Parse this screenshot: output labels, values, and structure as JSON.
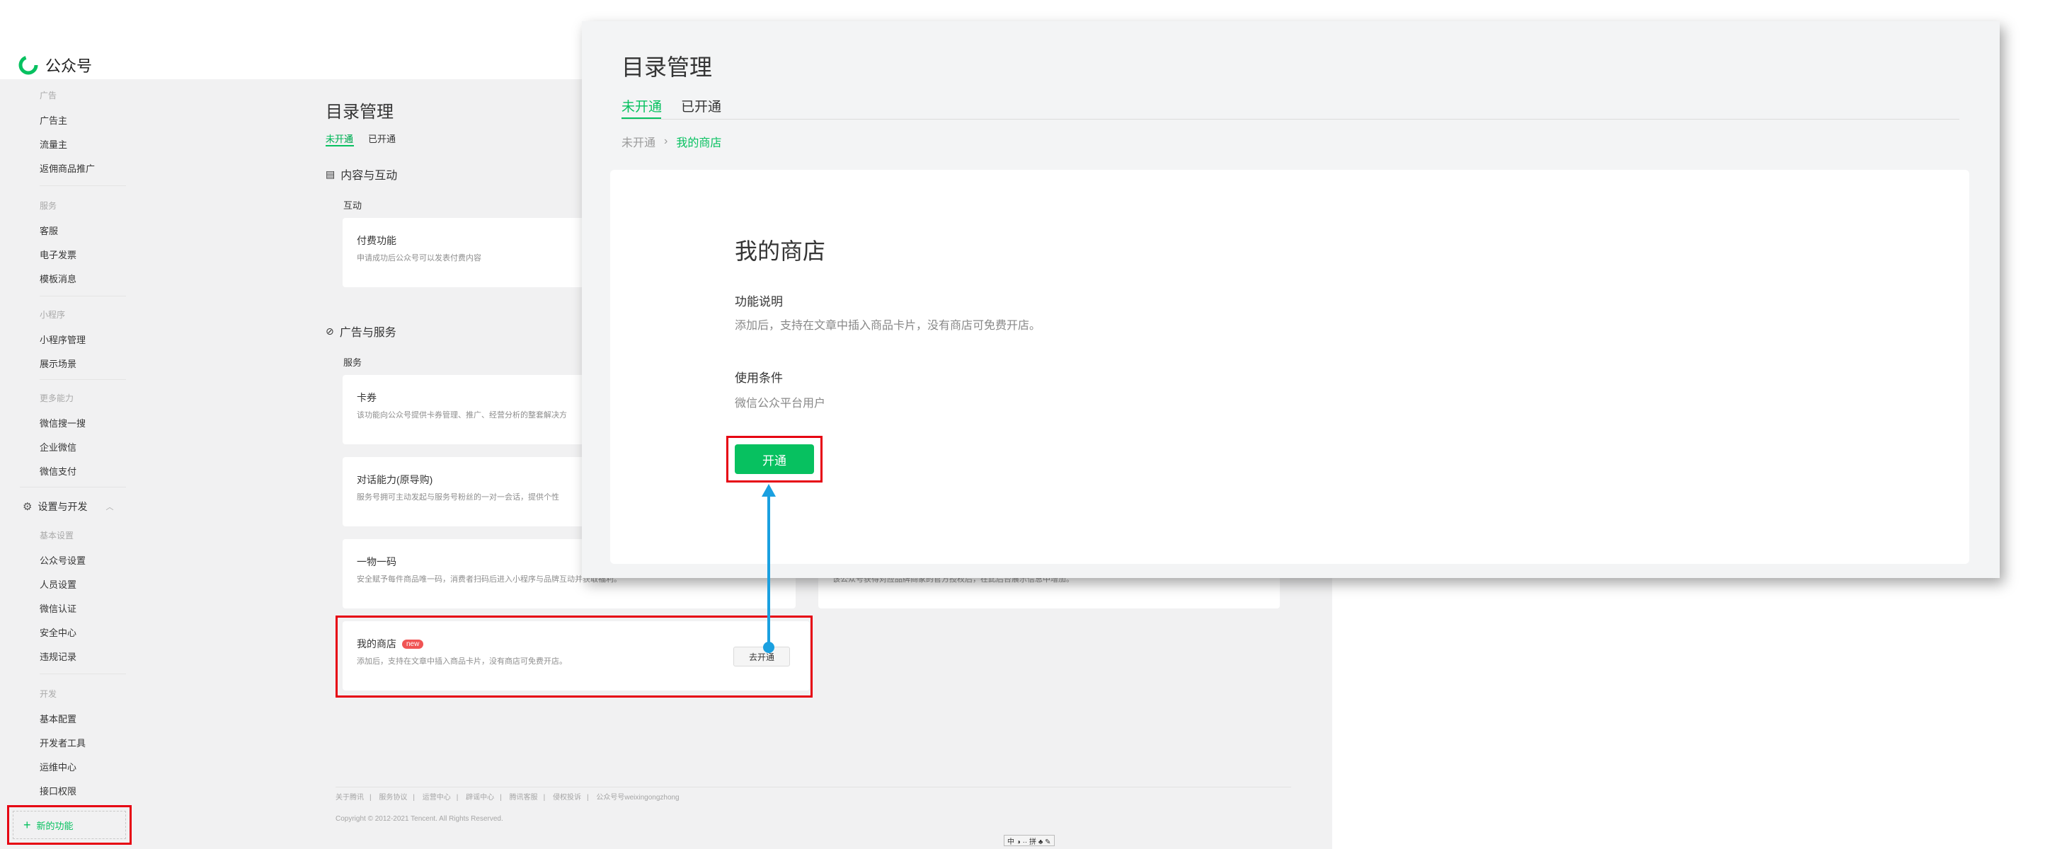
{
  "app": {
    "title": "公众号"
  },
  "sidebar": {
    "groups": [
      {
        "head": "广告",
        "items": [
          "广告主",
          "流量主",
          "返佣商品推广"
        ]
      },
      {
        "head": "服务",
        "items": [
          "客服",
          "电子发票",
          "模板消息"
        ]
      },
      {
        "head": "小程序",
        "items": [
          "小程序管理",
          "展示场景"
        ]
      },
      {
        "head": "更多能力",
        "items": [
          "微信搜一搜",
          "企业微信",
          "微信支付"
        ]
      }
    ],
    "section2": {
      "title": "设置与开发",
      "icon": "gear-icon"
    },
    "groups2": [
      {
        "head": "基本设置",
        "items": [
          "公众号设置",
          "人员设置",
          "微信认证",
          "安全中心",
          "违规记录"
        ]
      },
      {
        "head": "开发",
        "items": [
          "基本配置",
          "开发者工具",
          "运维中心",
          "接口权限"
        ]
      }
    ],
    "new_feature": "新的功能"
  },
  "page": {
    "title": "目录管理",
    "tabs": [
      "未开通",
      "已开通"
    ],
    "section1": {
      "title": "内容与互动",
      "sub": "互动"
    },
    "card_paid": {
      "title": "付费功能",
      "desc": "申请成功后公众号可以发表付费内容"
    },
    "section2": {
      "title": "广告与服务",
      "sub": "服务"
    },
    "card_coupon": {
      "title": "卡券",
      "desc": "该功能向公众号提供卡券管理、推广、经营分析的整套解决方"
    },
    "card_dialog": {
      "title": "对话能力(原导购)",
      "desc": "服务号拥可主动发起与服务号粉丝的一对一会话，提供个性"
    },
    "card_code": {
      "title": "一物一码",
      "desc": "安全赋予每件商品唯一码，消费者扫码后进入小程序与品牌互动并获取福利。"
    },
    "card_right_desc": "该公众号获得对应品牌商家的官方授权后，在此后台展示信息中增加。",
    "card_shop": {
      "title": "我的商店",
      "badge": "new",
      "desc": "添加后，支持在文章中插入商品卡片，没有商店可免费开店。",
      "button": "去开通"
    },
    "footer_links": [
      "关于腾讯",
      "服务协议",
      "运营中心",
      "辟谣中心",
      "腾讯客服",
      "侵权投诉",
      "公众号号weixingongzhong"
    ],
    "copyright": "Copyright © 2012-2021 Tencent. All Rights Reserved.",
    "ime_bar": "中 ◑ ·· 拼 ♣ ✎"
  },
  "modal": {
    "title": "目录管理",
    "tabs": [
      "未开通",
      "已开通"
    ],
    "breadcrumb": [
      "未开通",
      "我的商店"
    ],
    "heading": "我的商店",
    "func_label": "功能说明",
    "func_desc": "添加后，支持在文章中插入商品卡片，没有商店可免费开店。",
    "cond_label": "使用条件",
    "cond_desc": "微信公众平台用户",
    "open_button": "开通"
  },
  "colors": {
    "accent": "#07c160",
    "annotation_red": "#e60012",
    "arrow_blue": "#1aa0e0"
  }
}
